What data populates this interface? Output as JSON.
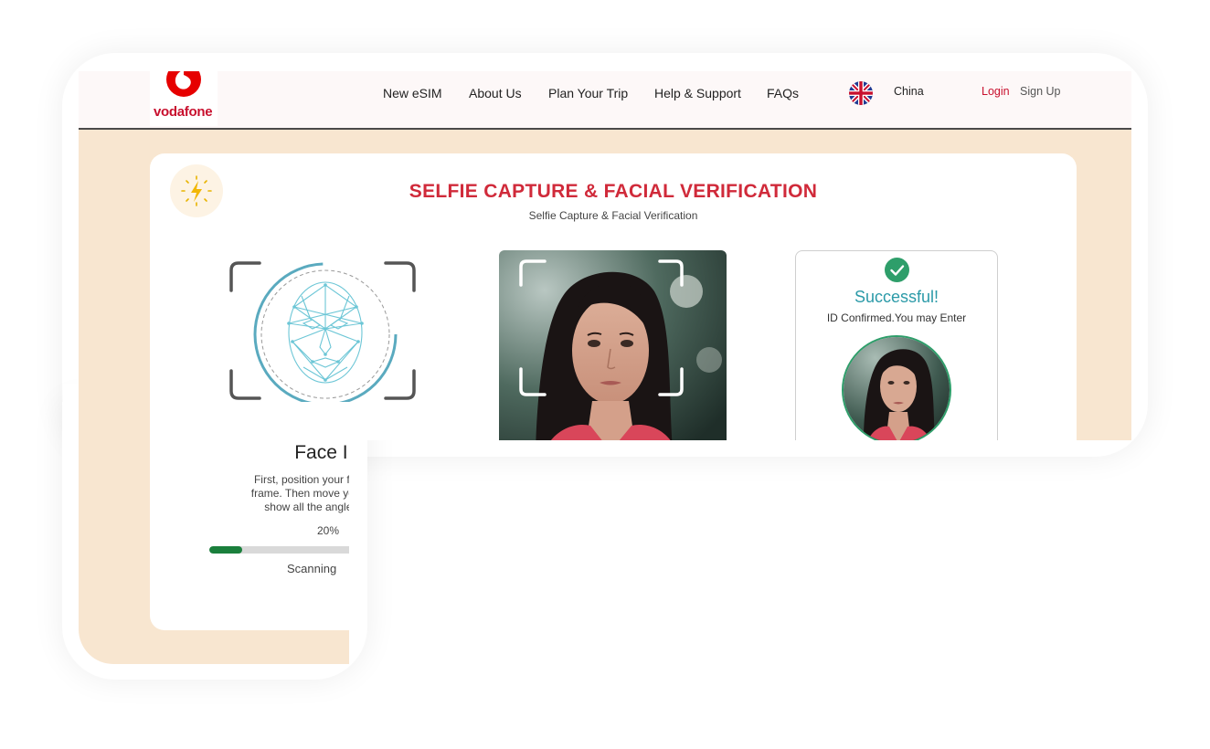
{
  "brand": {
    "name": "vodafone",
    "color": "#c8102e"
  },
  "nav": {
    "items": [
      "New eSIM",
      "About Us",
      "Plan Your Trip",
      "Help & Support",
      "FAQs"
    ],
    "language_icon": "uk-flag-icon",
    "country": "China",
    "login": "Login",
    "signup": "Sign Up"
  },
  "page": {
    "title": "SELFIE CAPTURE & FACIAL VERIFICATION",
    "subtitle": "Selfie Capture & Facial Verification",
    "badge_icon": "lightning-bolt-icon"
  },
  "face_id": {
    "title": "Face ID",
    "instruction_lines": [
      "First, position your face ir",
      "frame. Then move your he",
      "show all the angles c"
    ],
    "progress_label": "20%",
    "progress": 0.2,
    "status": "Scanning"
  },
  "result": {
    "icon": "check-icon",
    "title": "Successful!",
    "message": "ID Confirmed.You may Enter"
  },
  "colors": {
    "accent": "#d02a3a",
    "background": "#f8e6d0",
    "success": "#2e9e6a",
    "success_text": "#2b9aa8",
    "progress": "#1a7f3c"
  }
}
